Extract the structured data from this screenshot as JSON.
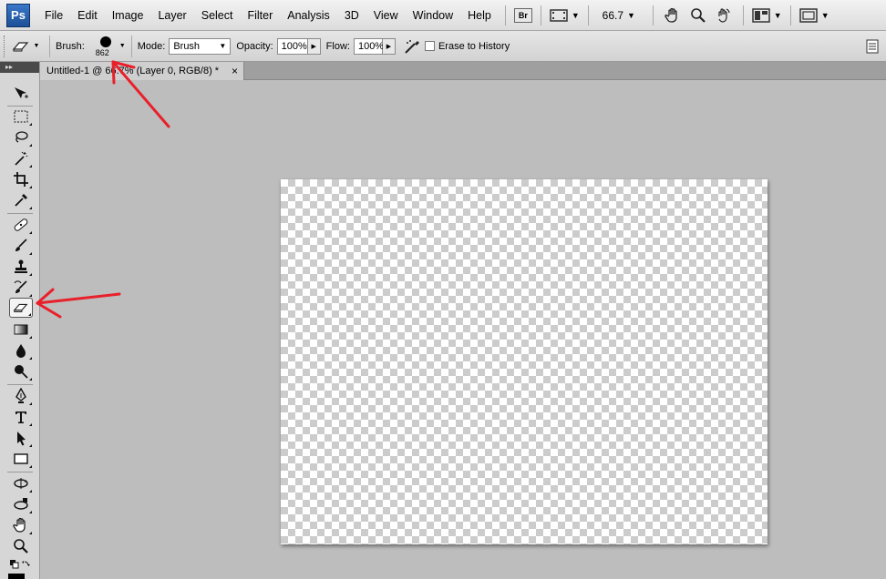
{
  "app": {
    "logo": "Ps"
  },
  "menu": [
    "File",
    "Edit",
    "Image",
    "Layer",
    "Select",
    "Filter",
    "Analysis",
    "3D",
    "View",
    "Window",
    "Help"
  ],
  "appbar": {
    "bridge": "Br",
    "zoom": "66.7"
  },
  "options": {
    "brush_label": "Brush:",
    "brush_size": "862",
    "mode_label": "Mode:",
    "mode_value": "Brush",
    "opacity_label": "Opacity:",
    "opacity_value": "100%",
    "flow_label": "Flow:",
    "flow_value": "100%",
    "erase_history_label": "Erase to History"
  },
  "document": {
    "tab_title": "Untitled-1 @ 66.7% (Layer 0, RGB/8) *",
    "close": "×"
  },
  "toolbox": {
    "header": "▸▸",
    "tools": [
      "move-tool",
      "marquee-tool",
      "lasso-tool",
      "magic-wand-tool",
      "crop-tool",
      "eyedropper-tool",
      "healing-brush-tool",
      "brush-tool",
      "clone-stamp-tool",
      "history-brush-tool",
      "eraser-tool",
      "gradient-tool",
      "blur-tool",
      "dodge-tool",
      "pen-tool",
      "type-tool",
      "path-selection-tool",
      "shape-tool",
      "3d-rotate-tool",
      "3d-orbit-tool",
      "hand-tool",
      "zoom-tool"
    ],
    "active_tool": "eraser-tool"
  },
  "colors": {
    "annotation_arrow": "#e8202a",
    "canvas_bg": "#bdbdbd"
  }
}
